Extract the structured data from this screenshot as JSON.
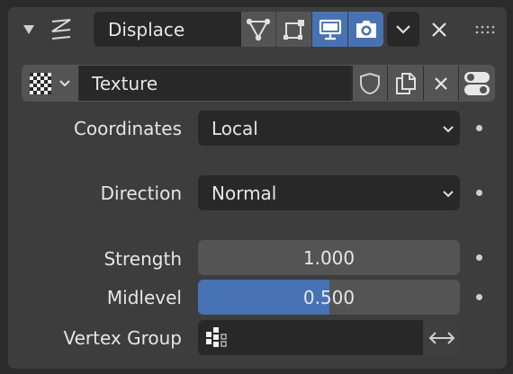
{
  "modifier": {
    "name": "Displace"
  },
  "texture": {
    "value": "Texture"
  },
  "rows": {
    "coordinates": {
      "label": "Coordinates",
      "value": "Local"
    },
    "direction": {
      "label": "Direction",
      "value": "Normal"
    },
    "strength": {
      "label": "Strength",
      "value": "1.000",
      "fraction": 0
    },
    "midlevel": {
      "label": "Midlevel",
      "value": "0.500",
      "fraction": 0.5
    },
    "vertex_group": {
      "label": "Vertex Group",
      "value": ""
    }
  },
  "colors": {
    "accent": "#4772b3",
    "panel": "#3d3d3d",
    "field": "#282828",
    "button": "#545454"
  }
}
